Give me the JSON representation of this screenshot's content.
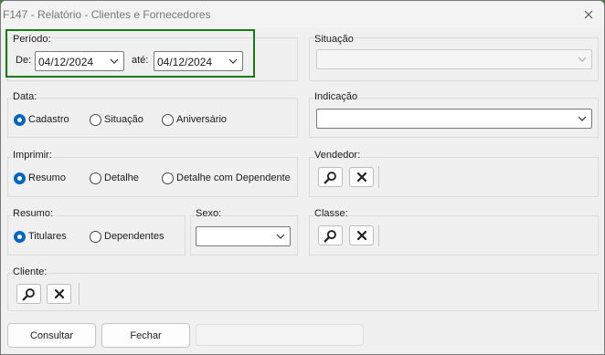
{
  "window": {
    "title": "F147 - Relatório - Clientes e Fornecedores",
    "close_icon": "close-icon"
  },
  "periodo": {
    "legend": "Período:",
    "de_label": "De:",
    "de_value": "04/12/2024",
    "ate_label": "até:",
    "ate_value": "04/12/2024"
  },
  "situacao": {
    "legend": "Situação",
    "value": ""
  },
  "data": {
    "legend": "Data:",
    "options": [
      "Cadastro",
      "Situação",
      "Aniversário"
    ],
    "selected": "Cadastro"
  },
  "indicacao": {
    "legend": "Indicação",
    "value": ""
  },
  "imprimir": {
    "legend": "Imprimir:",
    "options": [
      "Resumo",
      "Detalhe",
      "Detalhe com Dependente"
    ],
    "selected": "Resumo"
  },
  "vendedor": {
    "legend": "Vendedor:"
  },
  "resumo": {
    "legend": "Resumo:",
    "options": [
      "Titulares",
      "Dependentes"
    ],
    "selected": "Titulares"
  },
  "sexo": {
    "legend": "Sexo:",
    "value": ""
  },
  "classe": {
    "legend": "Classe:"
  },
  "cliente": {
    "legend": "Cliente:"
  },
  "footer": {
    "consultar_label": "Consultar",
    "fechar_label": "Fechar"
  },
  "colors": {
    "highlight": "#1a7a1a",
    "radio_selected": "#0067c0"
  }
}
